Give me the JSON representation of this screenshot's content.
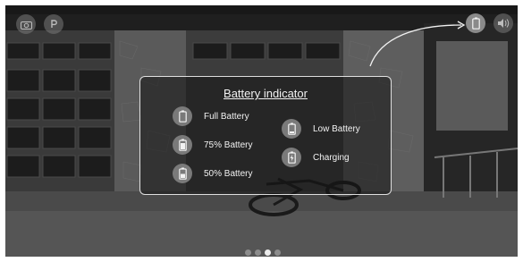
{
  "panel": {
    "title": "Battery indicator",
    "items": [
      {
        "label": "Full Battery",
        "icon": "battery-full-icon"
      },
      {
        "label": "75% Battery",
        "icon": "battery-75-icon"
      },
      {
        "label": "50% Battery",
        "icon": "battery-50-icon"
      },
      {
        "label": "Low Battery",
        "icon": "battery-low-icon"
      },
      {
        "label": "Charging",
        "icon": "battery-charging-icon"
      }
    ]
  },
  "top_icons": {
    "left": [
      "camera-icon",
      "parking-icon"
    ],
    "right": [
      "battery-icon",
      "volume-icon"
    ]
  },
  "pagination": {
    "count": 4,
    "active_index": 2
  },
  "colors": {
    "panel_border": "#ffffff",
    "icon_bubble": "#7a7a7a",
    "text": "#f2f2f2"
  }
}
